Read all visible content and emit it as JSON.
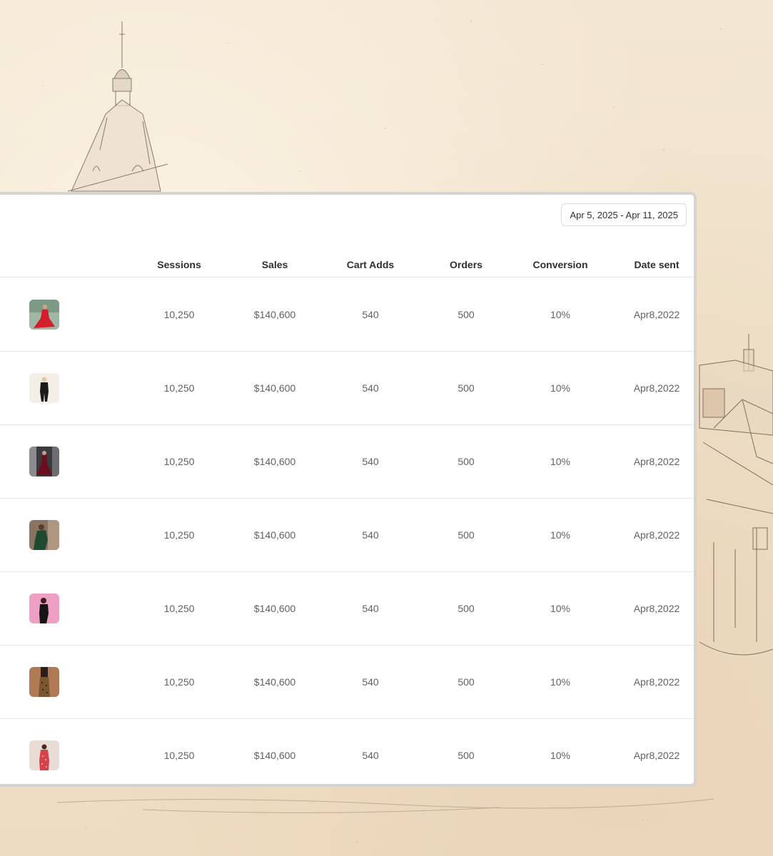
{
  "toolbar": {
    "date_range": "Apr 5, 2025 - Apr 11, 2025"
  },
  "table": {
    "columns": [
      "Sessions",
      "Sales",
      "Cart Adds",
      "Orders",
      "Conversion",
      "Date sent"
    ],
    "rows": [
      {
        "thumbnail": "red-dress-photo",
        "sessions": "10,250",
        "sales": "$140,600",
        "cart_adds": "540",
        "orders": "500",
        "conversion": "10%",
        "date_sent": "Apr8,2022"
      },
      {
        "thumbnail": "black-outfit-photo",
        "sessions": "10,250",
        "sales": "$140,600",
        "cart_adds": "540",
        "orders": "500",
        "conversion": "10%",
        "date_sent": "Apr8,2022"
      },
      {
        "thumbnail": "burgundy-gown-photo",
        "sessions": "10,250",
        "sales": "$140,600",
        "cart_adds": "540",
        "orders": "500",
        "conversion": "10%",
        "date_sent": "Apr8,2022"
      },
      {
        "thumbnail": "green-dress-photo",
        "sessions": "10,250",
        "sales": "$140,600",
        "cart_adds": "540",
        "orders": "500",
        "conversion": "10%",
        "date_sent": "Apr8,2022"
      },
      {
        "thumbnail": "pink-backdrop-photo",
        "sessions": "10,250",
        "sales": "$140,600",
        "cart_adds": "540",
        "orders": "500",
        "conversion": "10%",
        "date_sent": "Apr8,2022"
      },
      {
        "thumbnail": "leopard-dress-photo",
        "sessions": "10,250",
        "sales": "$140,600",
        "cart_adds": "540",
        "orders": "500",
        "conversion": "10%",
        "date_sent": "Apr8,2022"
      },
      {
        "thumbnail": "floral-dress-photo",
        "sessions": "10,250",
        "sales": "$140,600",
        "cart_adds": "540",
        "orders": "500",
        "conversion": "10%",
        "date_sent": "Apr8,2022"
      }
    ]
  }
}
